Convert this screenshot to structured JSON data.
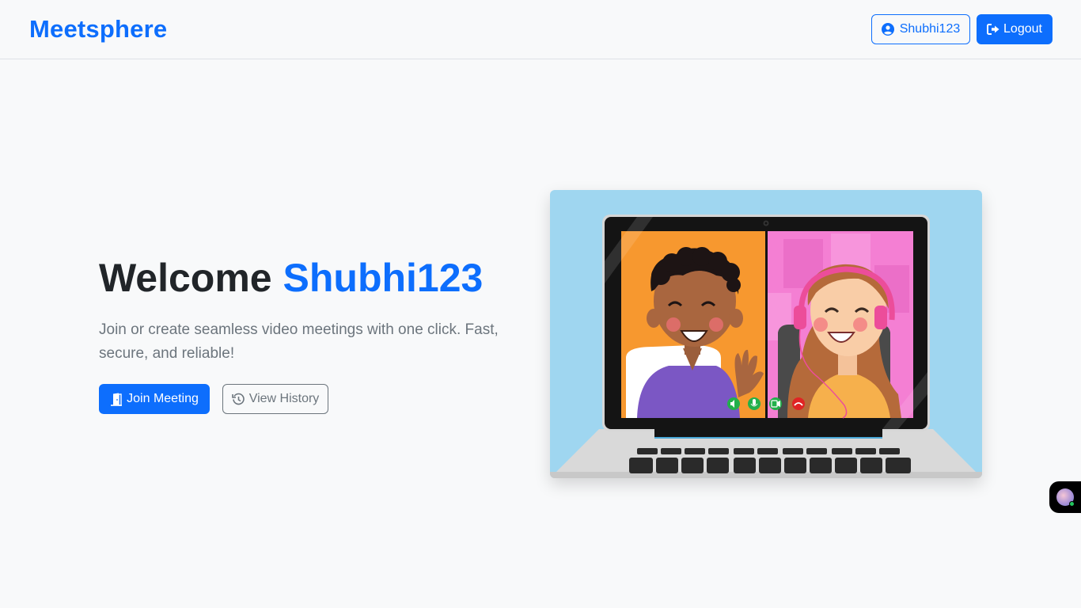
{
  "navbar": {
    "brand": "Meetsphere",
    "user_label": "Shubhi123",
    "logout_label": "Logout"
  },
  "hero": {
    "welcome": "Welcome",
    "username": "Shubhi123",
    "subtitle": "Join or create seamless video meetings with one click. Fast, secure, and reliable!",
    "join_label": "Join Meeting",
    "history_label": "View History"
  },
  "colors": {
    "primary": "#0d6efd",
    "secondary": "#6c757d",
    "background": "#f8f9fa"
  },
  "icons": [
    "user-circle-icon",
    "logout-icon",
    "door-icon",
    "history-icon",
    "speaker-icon",
    "mic-icon",
    "camera-icon",
    "hangup-icon"
  ]
}
